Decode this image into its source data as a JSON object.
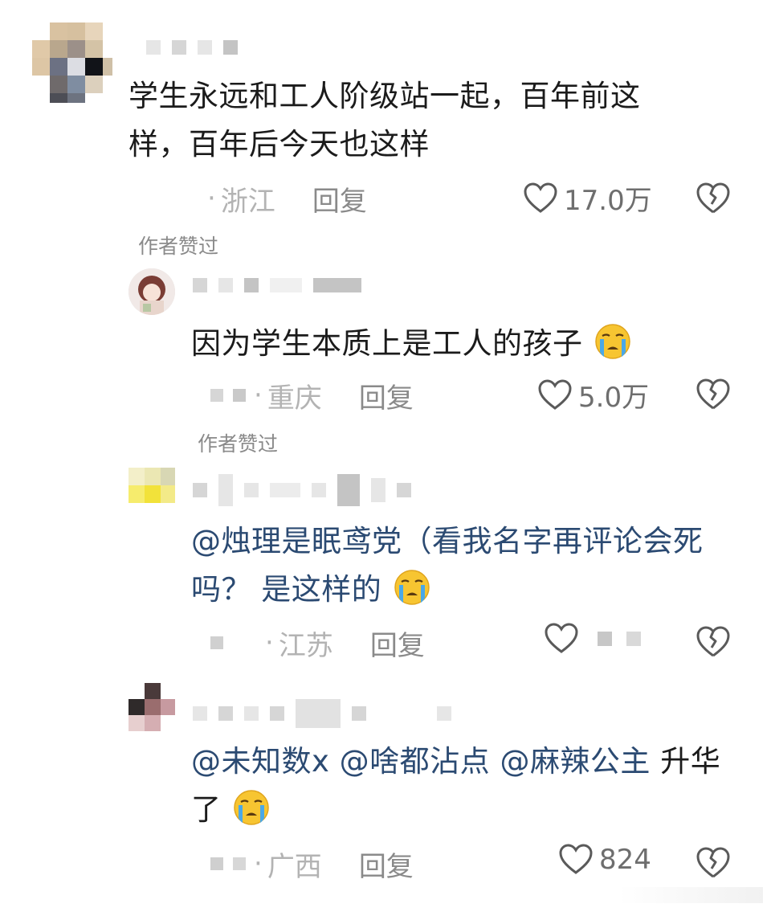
{
  "comments": [
    {
      "text": "学生永远和工人阶级站一起，百年前这样，百年后今天也这样",
      "location": "浙江",
      "reply": "回复",
      "likes": "17.0万",
      "author_liked": "作者赞过"
    },
    {
      "text": "因为学生本质上是工人的孩子",
      "location": "重庆",
      "reply": "回复",
      "likes": "5.0万",
      "author_liked": "作者赞过"
    },
    {
      "mention": "@烛理是眠鸢党",
      "text": "（看我名字再评论会死吗？ 是这样的",
      "location": "江苏",
      "reply": "回复"
    },
    {
      "mentions": [
        "@未知数x",
        "@啥都沾点",
        "@麻辣公主"
      ],
      "text": "升华了",
      "location": "广西",
      "reply": "回复",
      "likes": "824"
    }
  ],
  "icons": {
    "like": "heart-outline-icon",
    "dislike": "broken-heart-icon",
    "emoji": "crying-face-emoji"
  },
  "colors": {
    "mention": "#2b4a72",
    "location": "#b3b3b3",
    "reply": "#8a8a8a"
  }
}
